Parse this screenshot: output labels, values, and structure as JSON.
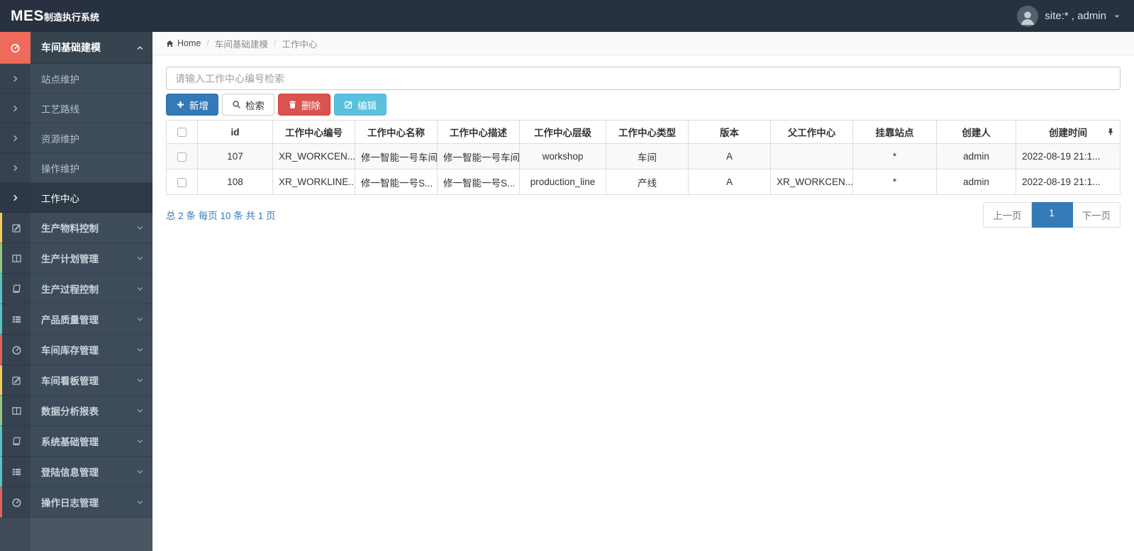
{
  "navbar": {
    "logo_mes": "MES",
    "logo_suffix": "制造执行系统",
    "user_label": "site:* , admin"
  },
  "breadcrumb": {
    "home": "Home",
    "items": [
      "车间基础建模",
      "工作中心"
    ]
  },
  "sidebar": {
    "active_group": {
      "id": "workshop-basic-modeling",
      "label": "车间基础建模",
      "icon": "dashboard-icon"
    },
    "submenu": [
      {
        "id": "station-maintenance",
        "label": "站点维护",
        "active": false
      },
      {
        "id": "process-route",
        "label": "工艺路线",
        "active": false
      },
      {
        "id": "resource-maintenance",
        "label": "资源维护",
        "active": false
      },
      {
        "id": "operation-maintenance",
        "label": "操作维护",
        "active": false
      },
      {
        "id": "work-center",
        "label": "工作中心",
        "active": true
      }
    ],
    "groups": [
      {
        "id": "production-material-control",
        "label": "生产物料控制",
        "icon": "edit-icon",
        "accent": "#f5c95c"
      },
      {
        "id": "production-plan-management",
        "label": "生产计划管理",
        "icon": "columns-icon",
        "accent": "#8fc97e"
      },
      {
        "id": "production-process-control",
        "label": "生产过程控制",
        "icon": "book-icon",
        "accent": "#56c5c5"
      },
      {
        "id": "product-quality-management",
        "label": "产品质量管理",
        "icon": "list-icon",
        "accent": "#56c5c5"
      },
      {
        "id": "workshop-inventory-management",
        "label": "车间库存管理",
        "icon": "dashboard-icon",
        "accent": "#e2615e"
      },
      {
        "id": "workshop-kanban-management",
        "label": "车间看板管理",
        "icon": "edit-icon",
        "accent": "#f5c95c"
      },
      {
        "id": "data-analysis-report",
        "label": "数据分析报表",
        "icon": "columns-icon",
        "accent": "#8fc97e"
      },
      {
        "id": "system-basic-management",
        "label": "系统基础管理",
        "icon": "book-icon",
        "accent": "#56c5c5"
      },
      {
        "id": "login-info-management",
        "label": "登陆信息管理",
        "icon": "list-icon",
        "accent": "#56c5c5"
      },
      {
        "id": "operation-log-management",
        "label": "操作日志管理",
        "icon": "dashboard-icon",
        "accent": "#e2615e"
      }
    ]
  },
  "search": {
    "placeholder": "请输入工作中心编号检索",
    "value": ""
  },
  "toolbar": {
    "add": "新增",
    "search": "检索",
    "delete": "删除",
    "edit": "编辑"
  },
  "table": {
    "columns": [
      {
        "key": "col-id",
        "label": "id"
      },
      {
        "key": "col-code",
        "label": "工作中心编号"
      },
      {
        "key": "col-name",
        "label": "工作中心名称"
      },
      {
        "key": "col-desc",
        "label": "工作中心描述"
      },
      {
        "key": "col-level",
        "label": "工作中心层级"
      },
      {
        "key": "col-type",
        "label": "工作中心类型"
      },
      {
        "key": "col-version",
        "label": "版本"
      },
      {
        "key": "col-parent",
        "label": "父工作中心"
      },
      {
        "key": "col-station",
        "label": "挂靠站点"
      },
      {
        "key": "col-creator",
        "label": "创建人"
      },
      {
        "key": "col-created",
        "label": "创建时间"
      }
    ],
    "rows": [
      [
        "107",
        "XR_WORKCEN...",
        "修一智能一号车间",
        "修一智能一号车间",
        "workshop",
        "车间",
        "A",
        "",
        "*",
        "admin",
        "2022-08-19 21:1..."
      ],
      [
        "108",
        "XR_WORKLINE...",
        "修一智能一号S...",
        "修一智能一号S...",
        "production_line",
        "产线",
        "A",
        "XR_WORKCEN...",
        "*",
        "admin",
        "2022-08-19 21:1..."
      ]
    ]
  },
  "pagination": {
    "summary": "总 2 条 每页 10 条 共 1 页",
    "prev": "上一页",
    "current": "1",
    "next": "下一页"
  },
  "colors": {
    "primary": "#337ab7",
    "danger": "#d9534f",
    "info": "#5bc0de",
    "navbar": "#273140",
    "sidebar": "#3e4b5a",
    "group_header_accent": "#ee6a5b"
  }
}
